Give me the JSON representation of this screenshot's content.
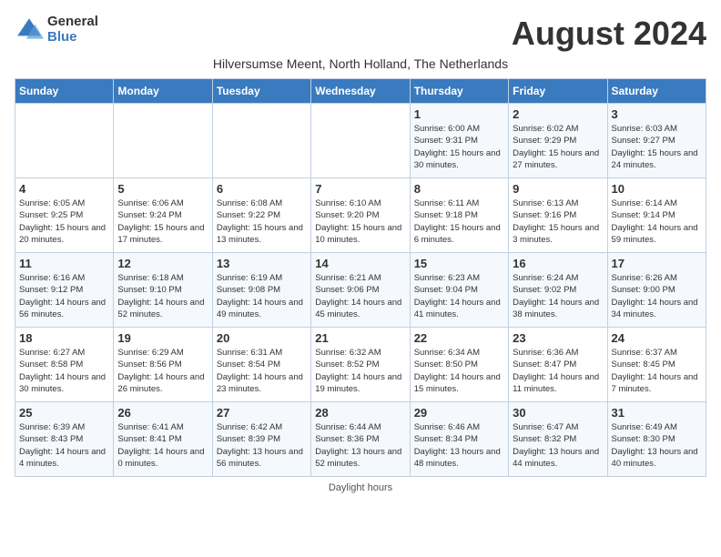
{
  "logo": {
    "general": "General",
    "blue": "Blue"
  },
  "title": "August 2024",
  "subtitle": "Hilversumse Meent, North Holland, The Netherlands",
  "days_of_week": [
    "Sunday",
    "Monday",
    "Tuesday",
    "Wednesday",
    "Thursday",
    "Friday",
    "Saturday"
  ],
  "footer": "Daylight hours",
  "weeks": [
    [
      {
        "day": "",
        "info": ""
      },
      {
        "day": "",
        "info": ""
      },
      {
        "day": "",
        "info": ""
      },
      {
        "day": "",
        "info": ""
      },
      {
        "day": "1",
        "info": "Sunrise: 6:00 AM\nSunset: 9:31 PM\nDaylight: 15 hours\nand 30 minutes."
      },
      {
        "day": "2",
        "info": "Sunrise: 6:02 AM\nSunset: 9:29 PM\nDaylight: 15 hours\nand 27 minutes."
      },
      {
        "day": "3",
        "info": "Sunrise: 6:03 AM\nSunset: 9:27 PM\nDaylight: 15 hours\nand 24 minutes."
      }
    ],
    [
      {
        "day": "4",
        "info": "Sunrise: 6:05 AM\nSunset: 9:25 PM\nDaylight: 15 hours\nand 20 minutes."
      },
      {
        "day": "5",
        "info": "Sunrise: 6:06 AM\nSunset: 9:24 PM\nDaylight: 15 hours\nand 17 minutes."
      },
      {
        "day": "6",
        "info": "Sunrise: 6:08 AM\nSunset: 9:22 PM\nDaylight: 15 hours\nand 13 minutes."
      },
      {
        "day": "7",
        "info": "Sunrise: 6:10 AM\nSunset: 9:20 PM\nDaylight: 15 hours\nand 10 minutes."
      },
      {
        "day": "8",
        "info": "Sunrise: 6:11 AM\nSunset: 9:18 PM\nDaylight: 15 hours\nand 6 minutes."
      },
      {
        "day": "9",
        "info": "Sunrise: 6:13 AM\nSunset: 9:16 PM\nDaylight: 15 hours\nand 3 minutes."
      },
      {
        "day": "10",
        "info": "Sunrise: 6:14 AM\nSunset: 9:14 PM\nDaylight: 14 hours\nand 59 minutes."
      }
    ],
    [
      {
        "day": "11",
        "info": "Sunrise: 6:16 AM\nSunset: 9:12 PM\nDaylight: 14 hours\nand 56 minutes."
      },
      {
        "day": "12",
        "info": "Sunrise: 6:18 AM\nSunset: 9:10 PM\nDaylight: 14 hours\nand 52 minutes."
      },
      {
        "day": "13",
        "info": "Sunrise: 6:19 AM\nSunset: 9:08 PM\nDaylight: 14 hours\nand 49 minutes."
      },
      {
        "day": "14",
        "info": "Sunrise: 6:21 AM\nSunset: 9:06 PM\nDaylight: 14 hours\nand 45 minutes."
      },
      {
        "day": "15",
        "info": "Sunrise: 6:23 AM\nSunset: 9:04 PM\nDaylight: 14 hours\nand 41 minutes."
      },
      {
        "day": "16",
        "info": "Sunrise: 6:24 AM\nSunset: 9:02 PM\nDaylight: 14 hours\nand 38 minutes."
      },
      {
        "day": "17",
        "info": "Sunrise: 6:26 AM\nSunset: 9:00 PM\nDaylight: 14 hours\nand 34 minutes."
      }
    ],
    [
      {
        "day": "18",
        "info": "Sunrise: 6:27 AM\nSunset: 8:58 PM\nDaylight: 14 hours\nand 30 minutes."
      },
      {
        "day": "19",
        "info": "Sunrise: 6:29 AM\nSunset: 8:56 PM\nDaylight: 14 hours\nand 26 minutes."
      },
      {
        "day": "20",
        "info": "Sunrise: 6:31 AM\nSunset: 8:54 PM\nDaylight: 14 hours\nand 23 minutes."
      },
      {
        "day": "21",
        "info": "Sunrise: 6:32 AM\nSunset: 8:52 PM\nDaylight: 14 hours\nand 19 minutes."
      },
      {
        "day": "22",
        "info": "Sunrise: 6:34 AM\nSunset: 8:50 PM\nDaylight: 14 hours\nand 15 minutes."
      },
      {
        "day": "23",
        "info": "Sunrise: 6:36 AM\nSunset: 8:47 PM\nDaylight: 14 hours\nand 11 minutes."
      },
      {
        "day": "24",
        "info": "Sunrise: 6:37 AM\nSunset: 8:45 PM\nDaylight: 14 hours\nand 7 minutes."
      }
    ],
    [
      {
        "day": "25",
        "info": "Sunrise: 6:39 AM\nSunset: 8:43 PM\nDaylight: 14 hours\nand 4 minutes."
      },
      {
        "day": "26",
        "info": "Sunrise: 6:41 AM\nSunset: 8:41 PM\nDaylight: 14 hours\nand 0 minutes."
      },
      {
        "day": "27",
        "info": "Sunrise: 6:42 AM\nSunset: 8:39 PM\nDaylight: 13 hours\nand 56 minutes."
      },
      {
        "day": "28",
        "info": "Sunrise: 6:44 AM\nSunset: 8:36 PM\nDaylight: 13 hours\nand 52 minutes."
      },
      {
        "day": "29",
        "info": "Sunrise: 6:46 AM\nSunset: 8:34 PM\nDaylight: 13 hours\nand 48 minutes."
      },
      {
        "day": "30",
        "info": "Sunrise: 6:47 AM\nSunset: 8:32 PM\nDaylight: 13 hours\nand 44 minutes."
      },
      {
        "day": "31",
        "info": "Sunrise: 6:49 AM\nSunset: 8:30 PM\nDaylight: 13 hours\nand 40 minutes."
      }
    ]
  ]
}
